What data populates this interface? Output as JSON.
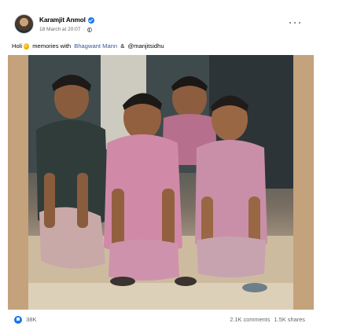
{
  "post": {
    "author": "Karamjit Anmol",
    "timestamp": "18 March at 20:07",
    "caption": {
      "prefix": "Holi",
      "emoji_icon": "balloon-icon",
      "middle": " memories with ",
      "mention1": "Bhagwant Mann",
      "separator": " & ",
      "mention2": "@manjitsidhu"
    },
    "photo_description": "group-photo",
    "stats": {
      "reactions": "38K",
      "comments": "2.1K comments",
      "shares": "1.5K shares"
    }
  },
  "colors": {
    "brand_blue": "#1877f2",
    "mention": "#385898",
    "secondary_text": "#65676b",
    "photo_border": "#c4a27c"
  },
  "icons": [
    "verified-badge-icon",
    "globe-icon",
    "more-options-icon",
    "balloon-icon",
    "like-reaction-icon"
  ]
}
